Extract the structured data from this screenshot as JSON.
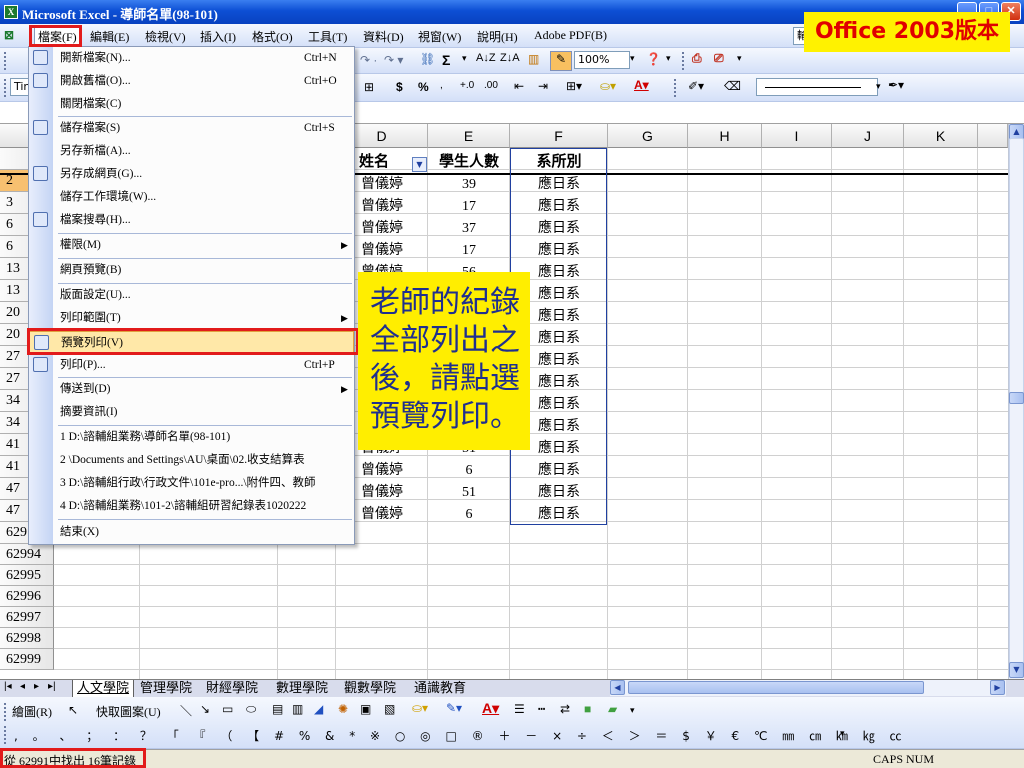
{
  "window": {
    "title": "Microsoft Excel - 導師名單(98-101)",
    "app_icon": "excel-icon"
  },
  "menubar": {
    "items": [
      "檔案(F)",
      "編輯(E)",
      "檢視(V)",
      "插入(I)",
      "格式(O)",
      "工具(T)",
      "資料(D)",
      "視窗(W)",
      "說明(H)",
      "Adobe PDF(B)"
    ],
    "help_box": "輸"
  },
  "toolbar": {
    "zoom": "100%",
    "font_name": "Tin",
    "currency": "$",
    "percent": "%"
  },
  "sheet": {
    "columns": [
      "D",
      "E",
      "F",
      "G",
      "H",
      "I",
      "J",
      "K"
    ],
    "visible_row_headers_partial": [
      "",
      "2",
      "3",
      "6",
      "6",
      "13",
      "13",
      "20",
      "20",
      "27",
      "27",
      "34",
      "34",
      "41",
      "41",
      "47",
      "47",
      "629"
    ],
    "header_row": {
      "name": "姓名",
      "students": "學生人數",
      "dept": "系所別"
    },
    "rows": [
      {
        "name": "曾儀婷",
        "students": "39",
        "dept": "應日系"
      },
      {
        "name": "曾儀婷",
        "students": "17",
        "dept": "應日系"
      },
      {
        "name": "曾儀婷",
        "students": "37",
        "dept": "應日系"
      },
      {
        "name": "曾儀婷",
        "students": "17",
        "dept": "應日系"
      },
      {
        "name": "曾儀婷",
        "students": "56",
        "dept": "應日系"
      },
      {
        "name": "",
        "students": "",
        "dept": "應日系"
      },
      {
        "name": "",
        "students": "",
        "dept": "應日系"
      },
      {
        "name": "",
        "students": "",
        "dept": "應日系"
      },
      {
        "name": "",
        "students": "",
        "dept": "應日系"
      },
      {
        "name": "",
        "students": "",
        "dept": "應日系"
      },
      {
        "name": "",
        "students": "",
        "dept": "應日系"
      },
      {
        "name": "",
        "students": "",
        "dept": "應日系"
      },
      {
        "name": "曾儀婷",
        "students": "51",
        "dept": "應日系"
      },
      {
        "name": "曾儀婷",
        "students": "6",
        "dept": "應日系"
      },
      {
        "name": "曾儀婷",
        "students": "51",
        "dept": "應日系"
      },
      {
        "name": "曾儀婷",
        "students": "6",
        "dept": "應日系"
      }
    ],
    "bottom_rows": [
      "62994",
      "62995",
      "62996",
      "62997",
      "62998",
      "62999"
    ]
  },
  "file_menu": {
    "items": [
      {
        "label": "開新檔案(N)...",
        "shortcut": "Ctrl+N"
      },
      {
        "label": "開啟舊檔(O)...",
        "shortcut": "Ctrl+O"
      },
      {
        "label": "關閉檔案(C)",
        "shortcut": ""
      },
      {
        "label": "儲存檔案(S)",
        "shortcut": "Ctrl+S"
      },
      {
        "label": "另存新檔(A)...",
        "shortcut": ""
      },
      {
        "label": "另存成網頁(G)...",
        "shortcut": ""
      },
      {
        "label": "儲存工作環境(W)...",
        "shortcut": ""
      },
      {
        "label": "檔案搜尋(H)...",
        "shortcut": ""
      },
      {
        "label": "權限(M)",
        "shortcut": ""
      },
      {
        "label": "網頁預覽(B)",
        "shortcut": ""
      },
      {
        "label": "版面設定(U)...",
        "shortcut": ""
      },
      {
        "label": "列印範圍(T)",
        "shortcut": ""
      },
      {
        "label": "預覽列印(V)",
        "shortcut": ""
      },
      {
        "label": "列印(P)...",
        "shortcut": "Ctrl+P"
      },
      {
        "label": "傳送到(D)",
        "shortcut": ""
      },
      {
        "label": "摘要資訊(I)",
        "shortcut": ""
      },
      {
        "label": "1 D:\\諮輔組業務\\導師名單(98-101)",
        "shortcut": ""
      },
      {
        "label": "2 \\Documents and Settings\\AU\\桌面\\02.收支結算表",
        "shortcut": ""
      },
      {
        "label": "3 D:\\諮輔組行政\\行政文件\\101e-pro...\\附件四、教師",
        "shortcut": ""
      },
      {
        "label": "4 D:\\諮輔組業務\\101-2\\諮輔組研習紀錄表1020222",
        "shortcut": ""
      },
      {
        "label": "結束(X)",
        "shortcut": ""
      }
    ]
  },
  "tabs": [
    "人文學院",
    "管理學院",
    "財經學院",
    "數理學院",
    "觀數學院",
    "通識教育"
  ],
  "drawbar": {
    "draw_label": "繪圖(R)",
    "autoshape_label": "快取圖案(U)",
    "symbols": ", 。 、 ； ： ？ 「 『 （ 【 # % & * ※ ○ ◎ □ ® ＋ － × ÷ ＜ ＞ ＝ $ ￥ € ℃ ㎜ ㎝ ㎞ ㎏ ㏄"
  },
  "status": {
    "left": "從 62991中找出 16筆記錄",
    "right": "CAPS NUM"
  },
  "annotation": {
    "note": "老師的紀錄全部列出之後，請點選預覽列印。",
    "version_badge": "Office 2003版本"
  },
  "colors": {
    "titlebar": "#0d4fd4",
    "highlight": "#e21b1b",
    "note_bg": "#ffee00",
    "note_text": "#1f2f8f"
  }
}
